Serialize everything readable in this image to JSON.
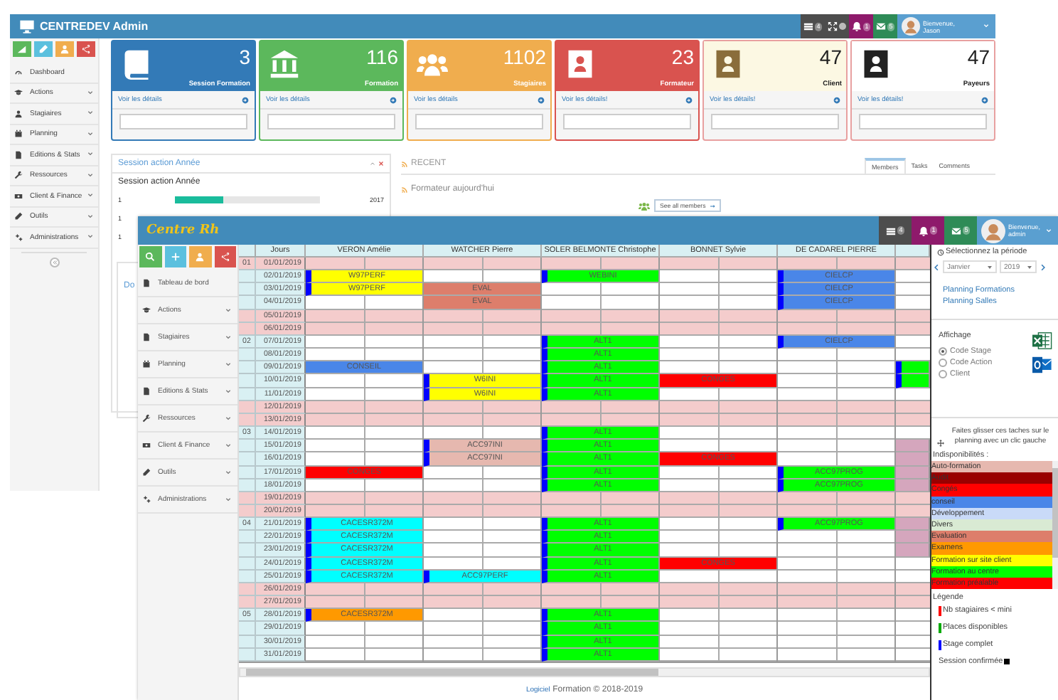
{
  "admin": {
    "title": "CENTREDEV Admin",
    "header_icons": [
      {
        "kind": "list",
        "badge": "4",
        "color": "#4d4d4d"
      },
      {
        "kind": "expand",
        "color": "#4d4d4d"
      },
      {
        "kind": "bell",
        "badge": "1",
        "color": "#8e1a6b"
      },
      {
        "kind": "envelope",
        "badge": "5",
        "color": "#2e8b57"
      }
    ],
    "user": {
      "greeting": "Bienvenue,",
      "name": "Jason"
    },
    "quick_buttons": [
      {
        "kind": "chart",
        "color": "#5cb85c"
      },
      {
        "kind": "pencil",
        "color": "#5bc0de"
      },
      {
        "kind": "user",
        "color": "#f0ad4e"
      },
      {
        "kind": "share",
        "color": "#d9534f"
      }
    ],
    "sidebar": [
      {
        "label": "Dashboard",
        "expandable": false
      },
      {
        "label": "Actions",
        "expandable": true
      },
      {
        "label": "Stagiaires",
        "expandable": true
      },
      {
        "label": "Planning",
        "expandable": true
      },
      {
        "label": "Editions & Stats",
        "expandable": true
      },
      {
        "label": "Ressources",
        "expandable": true
      },
      {
        "label": "Client & Finance",
        "expandable": true
      },
      {
        "label": "Outils",
        "expandable": true
      },
      {
        "label": "Administrations",
        "expandable": true
      }
    ],
    "cards": [
      {
        "value": "3",
        "label": "Session Formation",
        "link": "Voir les détails",
        "color": "#337ab7"
      },
      {
        "value": "116",
        "label": "Formation",
        "link": "Voir les détails",
        "color": "#5cb85c"
      },
      {
        "value": "1102",
        "label": "Stagiaires",
        "link": "Voir les détails",
        "color": "#f0ad4e"
      },
      {
        "value": "23",
        "label": "Formateur",
        "link": "Voir les détails!",
        "color": "#d9534f"
      },
      {
        "value": "47",
        "label": "Client",
        "link": "Voir les détails!",
        "color": "#fcf8e3"
      },
      {
        "value": "47",
        "label": "Payeurs",
        "link": "Voir les détails!",
        "color": "#ffffff"
      }
    ],
    "session_panel": {
      "title": "Session action Année",
      "subtitle": "Session action Année",
      "rows": [
        {
          "label": "1",
          "level": 0.33,
          "year": "2017"
        },
        {
          "label": "1"
        },
        {
          "label": "1"
        }
      ]
    },
    "docs_panel": {
      "title": "Do"
    },
    "recent": {
      "title": "RECENT",
      "item": "Formateur aujourd'hui",
      "button": "See all members",
      "tabs": [
        {
          "label": "Members",
          "selected": true
        },
        {
          "label": "Tasks",
          "selected": false
        },
        {
          "label": "Comments",
          "selected": false
        }
      ]
    }
  },
  "planning": {
    "title": "Centre Rh",
    "header_icons": [
      {
        "kind": "list",
        "badge": "4",
        "color": "#4d4d4d"
      },
      {
        "kind": "bell",
        "badge": "1",
        "color": "#8e1a6b"
      },
      {
        "kind": "envelope",
        "badge": "5",
        "color": "#2e8b57"
      }
    ],
    "user": {
      "greeting": "Bienvenue,",
      "name": "admin"
    },
    "quick_buttons": [
      {
        "kind": "search",
        "color": "#5cb85c"
      },
      {
        "kind": "plus",
        "color": "#5bc0de"
      },
      {
        "kind": "user",
        "color": "#f0ad4e"
      },
      {
        "kind": "share",
        "color": "#d9534f"
      }
    ],
    "sidebar": [
      {
        "label": "Tableau de bord",
        "expandable": false
      },
      {
        "label": "Actions",
        "expandable": true
      },
      {
        "label": "Stagiaires",
        "expandable": true
      },
      {
        "label": "Planning",
        "expandable": true
      },
      {
        "label": "Editions & Stats",
        "expandable": true
      },
      {
        "label": "Ressources",
        "expandable": true
      },
      {
        "label": "Client & Finance",
        "expandable": true
      },
      {
        "label": "Outils",
        "expandable": true
      },
      {
        "label": "Administrations",
        "expandable": true
      }
    ],
    "days_header": "Jours",
    "columns": [
      {
        "kind": "person",
        "name": "VERON Amélie"
      },
      {
        "kind": "person",
        "name": "WATCHER Pierre"
      },
      {
        "kind": "person",
        "name": "SOLER BELMONTE Christophe"
      },
      {
        "kind": "person",
        "name": "BONNET Sylvie"
      },
      {
        "kind": "person",
        "name": "DE CADAREL PIERRE"
      },
      {
        "kind": "partial"
      }
    ],
    "rows": [
      {
        "week": "01",
        "date": "01/01/2019",
        "weekend": true
      },
      {
        "date": "02/01/2019",
        "weekend": false,
        "cells": [
          {
            "kind": "event",
            "label": "W97PERF",
            "color": "#ffff00",
            "full": true
          },
          {
            "kind": "free"
          },
          {
            "kind": "event",
            "label": "WEBINI",
            "color": "#00ff00",
            "full": true
          },
          {
            "kind": "free"
          },
          {
            "kind": "event",
            "label": "CIELCP",
            "color": "#4a86e8",
            "full": true
          },
          {
            "kind": "free"
          }
        ]
      },
      {
        "date": "03/01/2019",
        "weekend": false,
        "cells": [
          {
            "kind": "event",
            "label": "W97PERF",
            "color": "#ffff00",
            "full": true
          },
          {
            "kind": "event",
            "label": "EVAL",
            "color": "#dd7e6b",
            "full": false
          },
          {
            "kind": "free"
          },
          {
            "kind": "free"
          },
          {
            "kind": "event",
            "label": "CIELCP",
            "color": "#4a86e8",
            "full": true
          },
          {
            "kind": "free"
          }
        ]
      },
      {
        "date": "04/01/2019",
        "weekend": false,
        "cells": [
          {
            "kind": "free"
          },
          {
            "kind": "event",
            "label": "EVAL",
            "color": "#dd7e6b",
            "full": false
          },
          {
            "kind": "free"
          },
          {
            "kind": "free"
          },
          {
            "kind": "event",
            "label": "CIELCP",
            "color": "#4a86e8",
            "full": true
          },
          {
            "kind": "free"
          }
        ]
      },
      {
        "date": "05/01/2019",
        "weekend": true
      },
      {
        "date": "06/01/2019",
        "weekend": true
      },
      {
        "week": "02",
        "date": "07/01/2019",
        "weekend": false,
        "cells": [
          {
            "kind": "free"
          },
          {
            "kind": "free"
          },
          {
            "kind": "event",
            "label": "ALT1",
            "color": "#00ff00",
            "full": true
          },
          {
            "kind": "free"
          },
          {
            "kind": "event",
            "label": "CIELCP",
            "color": "#4a86e8",
            "full": true
          },
          {
            "kind": "free"
          }
        ]
      },
      {
        "date": "08/01/2019",
        "weekend": false,
        "cells": [
          {
            "kind": "free"
          },
          {
            "kind": "free"
          },
          {
            "kind": "event",
            "label": "ALT1",
            "color": "#00ff00",
            "full": true
          },
          {
            "kind": "free"
          },
          {
            "kind": "free"
          },
          {
            "kind": "free"
          }
        ]
      },
      {
        "date": "09/01/2019",
        "weekend": false,
        "cells": [
          {
            "kind": "event",
            "label": "CONSEIL",
            "color": "#4a86e8",
            "full": false
          },
          {
            "kind": "free"
          },
          {
            "kind": "event",
            "label": "ALT1",
            "color": "#00ff00",
            "full": true
          },
          {
            "kind": "free"
          },
          {
            "kind": "free"
          },
          {
            "kind": "event",
            "color": "#00ff00",
            "full": true
          }
        ]
      },
      {
        "date": "10/01/2019",
        "weekend": false,
        "cells": [
          {
            "kind": "free"
          },
          {
            "kind": "event",
            "label": "W6INI",
            "color": "#ffff00",
            "full": true
          },
          {
            "kind": "event",
            "label": "ALT1",
            "color": "#00ff00",
            "full": true
          },
          {
            "kind": "event",
            "label": "CONGES",
            "color": "#ff0000",
            "full": false
          },
          {
            "kind": "free"
          },
          {
            "kind": "event",
            "color": "#00ff00",
            "full": true
          }
        ]
      },
      {
        "date": "11/01/2019",
        "weekend": false,
        "cells": [
          {
            "kind": "free"
          },
          {
            "kind": "event",
            "label": "W6INI",
            "color": "#ffff00",
            "full": true
          },
          {
            "kind": "event",
            "label": "ALT1",
            "color": "#00ff00",
            "full": true
          },
          {
            "kind": "free"
          },
          {
            "kind": "free"
          },
          {
            "kind": "free"
          }
        ]
      },
      {
        "date": "12/01/2019",
        "weekend": true
      },
      {
        "date": "13/01/2019",
        "weekend": true
      },
      {
        "week": "03",
        "date": "14/01/2019",
        "weekend": false,
        "cells": [
          {
            "kind": "free"
          },
          {
            "kind": "free"
          },
          {
            "kind": "event",
            "label": "ALT1",
            "color": "#00ff00",
            "full": true
          },
          {
            "kind": "free"
          },
          {
            "kind": "free"
          },
          {
            "kind": "free"
          }
        ]
      },
      {
        "date": "15/01/2019",
        "weekend": false,
        "cells": [
          {
            "kind": "free"
          },
          {
            "kind": "event",
            "label": "ACC97INI",
            "color": "#e6b8af",
            "full": true
          },
          {
            "kind": "event",
            "label": "ALT1",
            "color": "#00ff00",
            "full": true
          },
          {
            "kind": "free"
          },
          {
            "kind": "free"
          },
          {
            "kind": "event",
            "color": "#d5a6bd",
            "full": false
          }
        ]
      },
      {
        "date": "16/01/2019",
        "weekend": false,
        "cells": [
          {
            "kind": "free"
          },
          {
            "kind": "event",
            "label": "ACC97INI",
            "color": "#e6b8af",
            "full": true
          },
          {
            "kind": "event",
            "label": "ALT1",
            "color": "#00ff00",
            "full": true
          },
          {
            "kind": "event",
            "label": "CONGES",
            "color": "#ff0000",
            "full": false
          },
          {
            "kind": "free"
          },
          {
            "kind": "event",
            "color": "#d5a6bd",
            "full": false
          }
        ]
      },
      {
        "date": "17/01/2019",
        "weekend": false,
        "cells": [
          {
            "kind": "event",
            "label": "CONGES",
            "color": "#ff0000",
            "full": false
          },
          {
            "kind": "free"
          },
          {
            "kind": "event",
            "label": "ALT1",
            "color": "#00ff00",
            "full": true
          },
          {
            "kind": "free"
          },
          {
            "kind": "event",
            "label": "ACC97PROG",
            "color": "#00ff00",
            "full": true
          },
          {
            "kind": "event",
            "color": "#d5a6bd",
            "full": false
          }
        ]
      },
      {
        "date": "18/01/2019",
        "weekend": false,
        "cells": [
          {
            "kind": "free"
          },
          {
            "kind": "free"
          },
          {
            "kind": "event",
            "label": "ALT1",
            "color": "#00ff00",
            "full": true
          },
          {
            "kind": "free"
          },
          {
            "kind": "event",
            "label": "ACC97PROG",
            "color": "#00ff00",
            "full": true
          },
          {
            "kind": "event",
            "color": "#d5a6bd",
            "full": false
          }
        ]
      },
      {
        "date": "19/01/2019",
        "weekend": true
      },
      {
        "date": "20/01/2019",
        "weekend": true
      },
      {
        "week": "04",
        "date": "21/01/2019",
        "weekend": false,
        "cells": [
          {
            "kind": "event",
            "label": "CACESR372M",
            "color": "#00ffff",
            "full": true
          },
          {
            "kind": "free"
          },
          {
            "kind": "event",
            "label": "ALT1",
            "color": "#00ff00",
            "full": true
          },
          {
            "kind": "free"
          },
          {
            "kind": "event",
            "label": "ACC97PROG",
            "color": "#00ff00",
            "full": true
          },
          {
            "kind": "event",
            "color": "#d5a6bd",
            "full": false
          }
        ]
      },
      {
        "date": "22/01/2019",
        "weekend": false,
        "cells": [
          {
            "kind": "event",
            "label": "CACESR372M",
            "color": "#00ffff",
            "full": true
          },
          {
            "kind": "free"
          },
          {
            "kind": "event",
            "label": "ALT1",
            "color": "#00ff00",
            "full": true
          },
          {
            "kind": "free"
          },
          {
            "kind": "free"
          },
          {
            "kind": "event",
            "color": "#d5a6bd",
            "full": false
          }
        ]
      },
      {
        "date": "23/01/2019",
        "weekend": false,
        "cells": [
          {
            "kind": "event",
            "label": "CACESR372M",
            "color": "#00ffff",
            "full": true
          },
          {
            "kind": "free"
          },
          {
            "kind": "event",
            "label": "ALT1",
            "color": "#00ff00",
            "full": true
          },
          {
            "kind": "free"
          },
          {
            "kind": "free"
          },
          {
            "kind": "event",
            "color": "#d5a6bd",
            "full": false
          }
        ]
      },
      {
        "date": "24/01/2019",
        "weekend": false,
        "cells": [
          {
            "kind": "event",
            "label": "CACESR372M",
            "color": "#00ffff",
            "full": true
          },
          {
            "kind": "free"
          },
          {
            "kind": "event",
            "label": "ALT1",
            "color": "#00ff00",
            "full": true
          },
          {
            "kind": "event",
            "label": "CONGES",
            "color": "#ff0000",
            "full": false
          },
          {
            "kind": "free"
          },
          {
            "kind": "free"
          }
        ]
      },
      {
        "date": "25/01/2019",
        "weekend": false,
        "cells": [
          {
            "kind": "event",
            "label": "CACESR372M",
            "color": "#00ffff",
            "full": true
          },
          {
            "kind": "event",
            "label": "ACC97PERF",
            "color": "#00ffff",
            "full": true
          },
          {
            "kind": "event",
            "label": "ALT1",
            "color": "#00ff00",
            "full": true
          },
          {
            "kind": "free"
          },
          {
            "kind": "free"
          },
          {
            "kind": "free"
          }
        ]
      },
      {
        "date": "26/01/2019",
        "weekend": true
      },
      {
        "date": "27/01/2019",
        "weekend": true
      },
      {
        "week": "05",
        "date": "28/01/2019",
        "weekend": false,
        "cells": [
          {
            "kind": "event",
            "label": "CACESR372M",
            "color": "#ff9900",
            "full": true
          },
          {
            "kind": "free"
          },
          {
            "kind": "event",
            "label": "ALT1",
            "color": "#00ff00",
            "full": true
          },
          {
            "kind": "free"
          },
          {
            "kind": "free"
          },
          {
            "kind": "free"
          }
        ]
      },
      {
        "date": "29/01/2019",
        "weekend": false,
        "cells": [
          {
            "kind": "free"
          },
          {
            "kind": "free"
          },
          {
            "kind": "event",
            "label": "ALT1",
            "color": "#00ff00",
            "full": true
          },
          {
            "kind": "free"
          },
          {
            "kind": "free"
          },
          {
            "kind": "free"
          }
        ]
      },
      {
        "date": "30/01/2019",
        "weekend": false,
        "cells": [
          {
            "kind": "free"
          },
          {
            "kind": "free"
          },
          {
            "kind": "event",
            "label": "ALT1",
            "color": "#00ff00",
            "full": true
          },
          {
            "kind": "free"
          },
          {
            "kind": "free"
          },
          {
            "kind": "free"
          }
        ]
      },
      {
        "date": "31/01/2019",
        "weekend": false,
        "cells": [
          {
            "kind": "free"
          },
          {
            "kind": "free"
          },
          {
            "kind": "event",
            "label": "ALT1",
            "color": "#00ff00",
            "full": true
          },
          {
            "kind": "free"
          },
          {
            "kind": "free"
          },
          {
            "kind": "free"
          }
        ]
      }
    ],
    "footer": {
      "link": "Logiciel",
      "text": "Formation © 2018-2019"
    },
    "side_panel": {
      "period_label": "Sélectionnez la période",
      "month": "Janvier",
      "year": "2019",
      "links": [
        "Planning Formations",
        "Planning Salles"
      ],
      "display_label": "Affichage",
      "display_options": [
        {
          "label": "Code Stage",
          "selected": true
        },
        {
          "label": "Code Action",
          "selected": false
        },
        {
          "label": "Client",
          "selected": false
        }
      ],
      "drag_hint": "Faites glisser ces taches sur le planning avec un clic gauche",
      "unavailable_label": "Indisponibilités :",
      "unavailable": [
        {
          "label": "Auto-formation",
          "color": "#e6b8af"
        },
        {
          "label": "Audit",
          "color": "#990000"
        },
        {
          "label": "Congés",
          "color": "#ff0000"
        },
        {
          "label": "conseil",
          "color": "#4a86e8"
        },
        {
          "label": "Développement",
          "color": "#c9daf8"
        },
        {
          "label": "Divers",
          "color": "#d9ead3"
        },
        {
          "label": "Evaluation",
          "color": "#dd7e6b"
        },
        {
          "label": "Examens",
          "color": "#ff9900"
        },
        {
          "label": "Formation sur site client",
          "color": "#ffff00"
        },
        {
          "label": "Formation au centre",
          "color": "#00ff00"
        },
        {
          "label": "Formation préalable",
          "color": "#ff0000"
        }
      ],
      "legend_label": "Légende",
      "legend": [
        {
          "kind": "bar",
          "label": "Nb stagiaires < mini",
          "color": "#ff0000"
        },
        {
          "kind": "bar",
          "label": "Places disponibles",
          "color": "#00aa00"
        },
        {
          "kind": "bar",
          "label": "Stage complet",
          "color": "#0000ff"
        },
        {
          "kind": "square",
          "label": "Session confirmée",
          "color": "#000000"
        }
      ]
    }
  }
}
